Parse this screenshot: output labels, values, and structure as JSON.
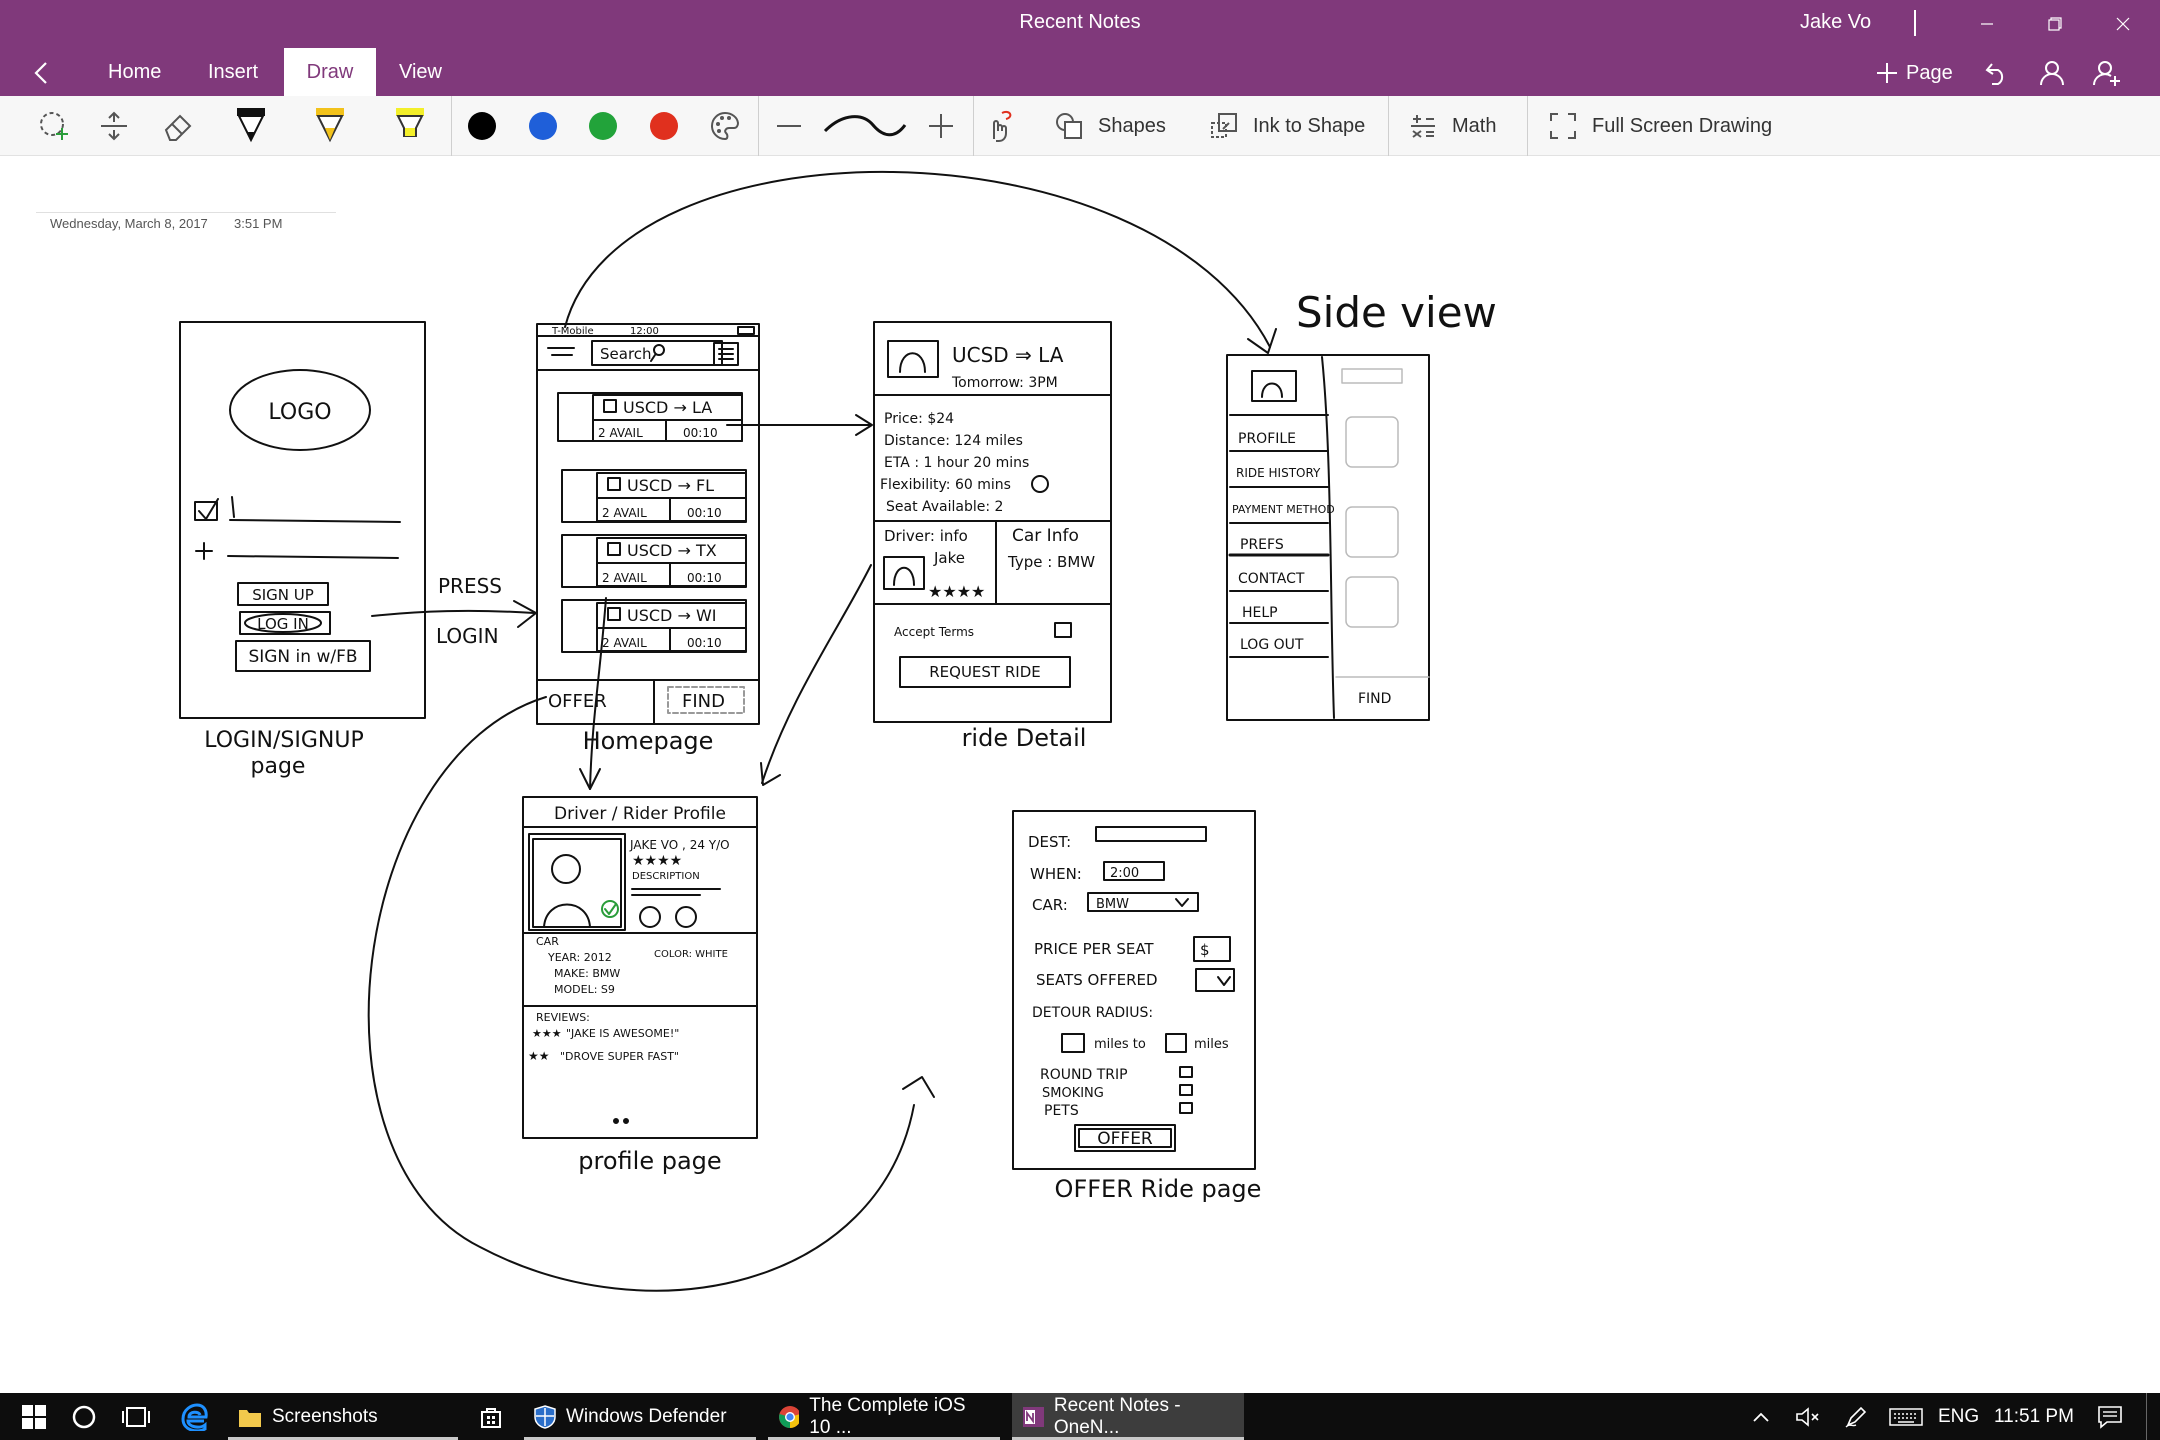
{
  "window": {
    "title": "Recent Notes",
    "user": "Jake Vo"
  },
  "ribbon": {
    "tabs": [
      "Home",
      "Insert",
      "Draw",
      "View"
    ],
    "active_tab": "Draw",
    "add_page_label": "Page"
  },
  "toolbar": {
    "pen_colors": [
      "#000000",
      "#1f5fd9",
      "#22a33a",
      "#e0301e"
    ],
    "shapes_label": "Shapes",
    "ink_to_shape_label": "Ink to Shape",
    "math_label": "Math",
    "full_screen_label": "Full Screen Drawing"
  },
  "note": {
    "date": "Wednesday, March 8, 2017",
    "time": "3:51 PM"
  },
  "sketch": {
    "login_screen": {
      "logo": "LOGO",
      "signup": "SIGN UP",
      "login": "LOG IN",
      "signin_fb": "SIGN in w/FB",
      "caption_1": "LOGIN/SIGNUP",
      "caption_2": "page"
    },
    "press_label": "PRESS",
    "login_label": "LOGIN",
    "homepage": {
      "status_left": "T-Mobile",
      "status_time": "12:00",
      "search": "Search",
      "rides": [
        {
          "route": "USCD → LA",
          "avail": "2 AVAIL",
          "time": "00:10"
        },
        {
          "route": "USCD → FL",
          "avail": "2 AVAIL",
          "time": "00:10"
        },
        {
          "route": "USCD → TX",
          "avail": "2 AVAIL",
          "time": "00:10"
        },
        {
          "route": "USCD → WI",
          "avail": "2 AVAIL",
          "time": "00:10"
        }
      ],
      "offer_tab": "OFFER",
      "find_tab": "FIND",
      "caption": "Homepage"
    },
    "ride_detail": {
      "route": "UCSD ⇒ LA",
      "when": "Tomorrow: 3PM",
      "price": "Price: $24",
      "distance": "Distance: 124 miles",
      "eta": "ETA : 1 hour 20 mins",
      "flexibility": "Flexibility: 60 mins",
      "seats": "Seat Available: 2",
      "driver_info": "Driver: info",
      "driver_name": "Jake",
      "car_info": "Car Info",
      "car_type": "Type : BMW",
      "accept_terms": "Accept Terms",
      "request": "REQUEST RIDE",
      "caption": "ride Detail"
    },
    "side_view": {
      "title": "Side view",
      "items": [
        "PROFILE",
        "RIDE HISTORY",
        "PAYMENT METHOD",
        "PREFS",
        "CONTACT",
        "HELP",
        "LOG OUT"
      ],
      "find": "FIND"
    },
    "profile": {
      "header": "Driver / Rider Profile",
      "name_age": "JAKE VO , 24 Y/O",
      "description": "DESCRIPTION",
      "car": "CAR",
      "year": "YEAR: 2012",
      "make": "MAKE: BMW",
      "model": "MODEL: S9",
      "color": "COLOR: WHITE",
      "reviews": "REVIEWS:",
      "review_1": "\"JAKE IS AWESOME!\"",
      "review_2": "\"DROVE SUPER FAST\"",
      "caption": "profile page"
    },
    "offer": {
      "dest": "DEST:",
      "when": "WHEN:",
      "when_value": "2:00",
      "car": "CAR:",
      "car_value": "BMW",
      "price": "PRICE PER SEAT",
      "price_value": "$",
      "seats": "SEATS OFFERED",
      "detour": "DETOUR RADIUS:",
      "miles_to": "miles to",
      "miles": "miles",
      "round_trip": "ROUND TRIP",
      "smoking": "SMOKING",
      "pets": "PETS",
      "offer_btn": "OFFER",
      "caption": "OFFER Ride page"
    }
  },
  "taskbar": {
    "apps": [
      {
        "label": "Screenshots"
      },
      {
        "label": "Windows Defender"
      },
      {
        "label": "The Complete iOS 10 ..."
      },
      {
        "label": "Recent Notes - OneN..."
      }
    ],
    "language": "ENG",
    "clock": "11:51 PM"
  }
}
